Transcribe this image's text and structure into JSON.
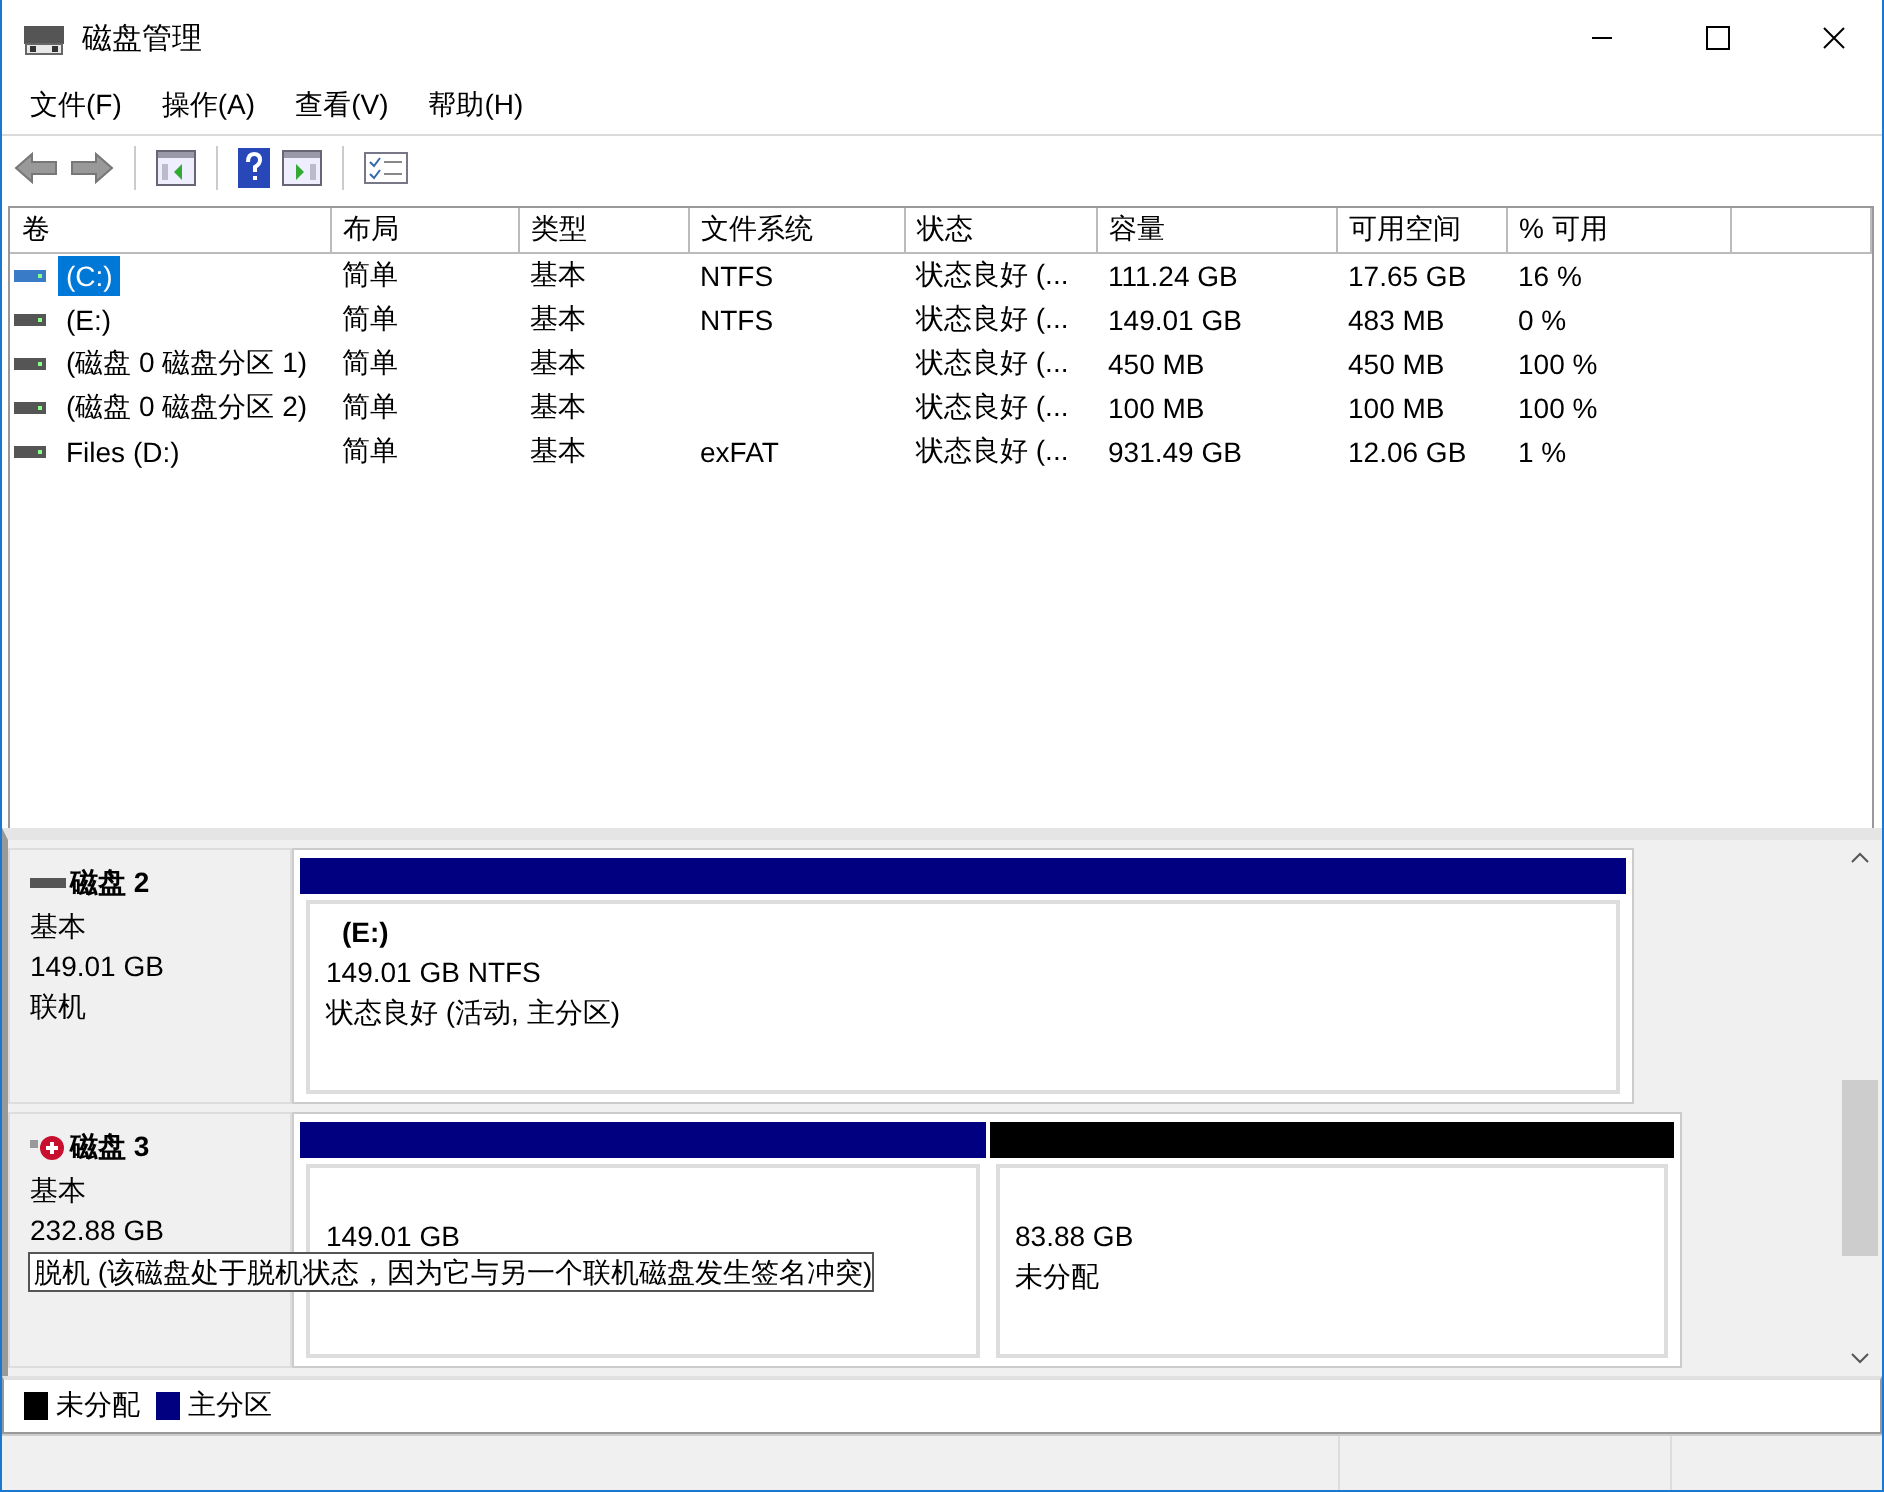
{
  "window": {
    "title": "磁盘管理"
  },
  "menu": [
    "文件(F)",
    "操作(A)",
    "查看(V)",
    "帮助(H)"
  ],
  "table": {
    "columns": [
      "卷",
      "布局",
      "类型",
      "文件系统",
      "状态",
      "容量",
      "可用空间",
      "% 可用"
    ],
    "rows": [
      {
        "cells": [
          "(C:)",
          "简单",
          "基本",
          "NTFS",
          "状态良好 (...",
          "111.24 GB",
          "17.65 GB",
          "16 %"
        ],
        "selected": true
      },
      {
        "cells": [
          "(E:)",
          "简单",
          "基本",
          "NTFS",
          "状态良好 (...",
          "149.01 GB",
          "483 MB",
          "0 %"
        ],
        "selected": false
      },
      {
        "cells": [
          "(磁盘 0 磁盘分区 1)",
          "简单",
          "基本",
          "",
          "状态良好 (...",
          "450 MB",
          "450 MB",
          "100 %"
        ],
        "selected": false
      },
      {
        "cells": [
          "(磁盘 0 磁盘分区 2)",
          "简单",
          "基本",
          "",
          "状态良好 (...",
          "100 MB",
          "100 MB",
          "100 %"
        ],
        "selected": false
      },
      {
        "cells": [
          "Files (D:)",
          "简单",
          "基本",
          "exFAT",
          "状态良好 (...",
          "931.49 GB",
          "12.06 GB",
          "1 %"
        ],
        "selected": false
      }
    ]
  },
  "disks": [
    {
      "name": "磁盘 2",
      "type": "基本",
      "size": "149.01 GB",
      "status": "联机",
      "offline": false,
      "partitions": [
        {
          "kind": "primary",
          "label": "(E:)",
          "lines": [
            "149.01 GB NTFS",
            "状态良好 (活动, 主分区)"
          ]
        }
      ]
    },
    {
      "name": "磁盘 3",
      "type": "基本",
      "size": "232.88 GB",
      "status": "脱机 (该磁盘处于脱机状态，因为它与另一个联机磁盘发生签名冲突)",
      "offline": true,
      "partitions": [
        {
          "kind": "primary",
          "lines": [
            "149.01 GB"
          ]
        },
        {
          "kind": "unallocated",
          "lines": [
            "83.88 GB",
            "未分配"
          ]
        }
      ]
    }
  ],
  "legend": [
    {
      "label": "未分配",
      "color": "#000000"
    },
    {
      "label": "主分区",
      "color": "#000080"
    }
  ]
}
